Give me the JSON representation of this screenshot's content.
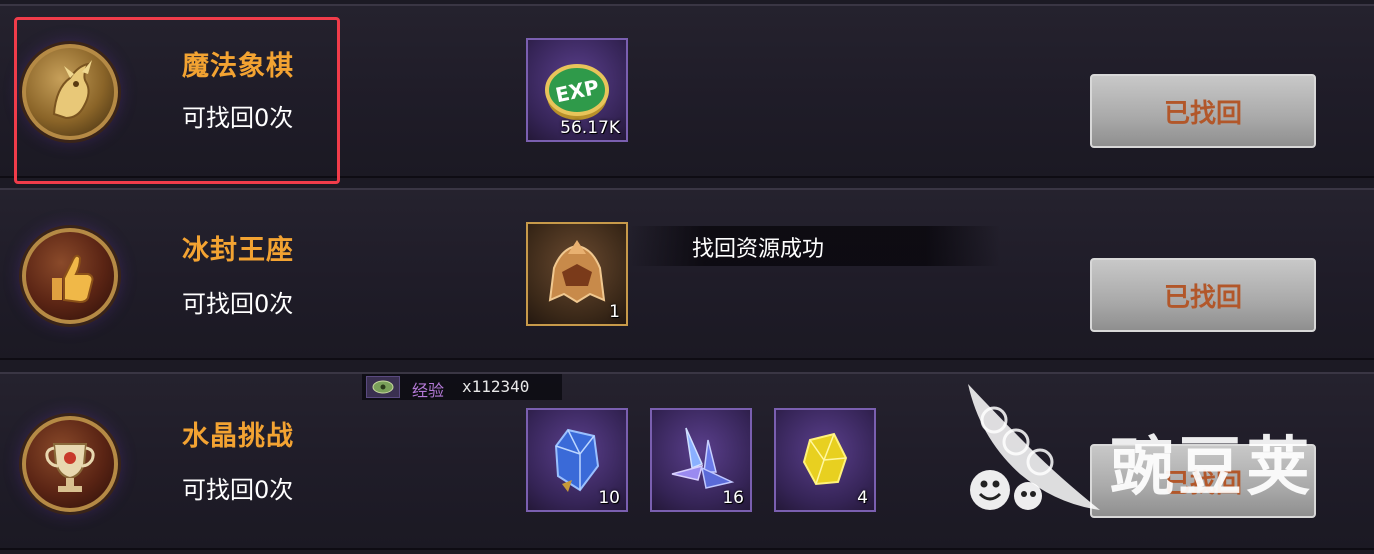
{
  "rows": [
    {
      "title": "魔法象棋",
      "count": "可找回0次",
      "medal_icon": "golden-dragon-medal-icon",
      "items": [
        {
          "icon": "exp-coin-icon",
          "qty": "56.17K"
        }
      ],
      "button": "已找回"
    },
    {
      "title": "冰封王座",
      "count": "可找回0次",
      "medal_icon": "thumbs-up-medal-icon",
      "items": [
        {
          "icon": "golden-helmet-icon",
          "qty": "1"
        }
      ],
      "button": "已找回"
    },
    {
      "title": "水晶挑战",
      "count": "可找回0次",
      "medal_icon": "trophy-medal-icon",
      "items": [
        {
          "icon": "blue-crystal-icon",
          "qty": "10"
        },
        {
          "icon": "purple-crystal-shards-icon",
          "qty": "16"
        },
        {
          "icon": "yellow-crystal-icon",
          "qty": "4"
        }
      ],
      "button": "已找回"
    }
  ],
  "toast": {
    "text": "找回资源成功"
  },
  "exp_popup": {
    "label": "经验",
    "value": "x112340",
    "icon": "exp-eye-icon"
  },
  "watermark": {
    "text": "豌豆荚",
    "icon": "pea-pod-logo"
  },
  "colors": {
    "title": "#f3a332",
    "button_text": "#b2572a",
    "highlight": "#f03c4a",
    "exp_label": "#b57ad8"
  }
}
